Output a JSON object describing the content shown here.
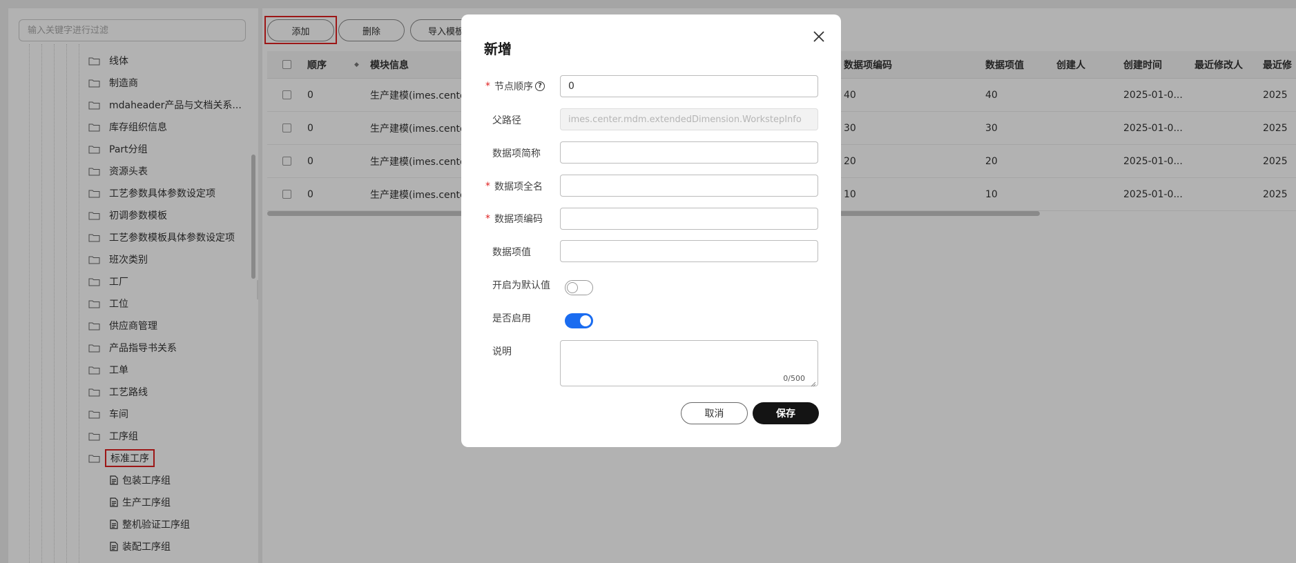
{
  "tree": {
    "filter_placeholder": "输入关键字进行过滤",
    "folders": [
      "线体",
      "制造商",
      "mdaheader产品与文档关系...",
      "库存组织信息",
      "Part分组",
      "资源头表",
      "工艺参数具体参数设定项",
      "初调参数模板",
      "工艺参数模板具体参数设定项",
      "班次类别",
      "工厂",
      "工位",
      "供应商管理",
      "产品指导书关系",
      "工单",
      "工艺路线",
      "车间",
      "工序组"
    ],
    "selected_folder": "标准工序",
    "children": [
      "包装工序组",
      "生产工序组",
      "整机验证工序组",
      "装配工序组"
    ]
  },
  "toolbar": {
    "add_label": "添加",
    "delete_label": "删除",
    "import_label": "导入模板"
  },
  "grid": {
    "headers": {
      "order": "顺序",
      "module": "模块信息",
      "code": "数据项编码",
      "value": "数据项值",
      "creator": "创建人",
      "created_time": "创建时间",
      "modifier": "最近修改人",
      "modified_time": "最近修"
    },
    "rows": [
      {
        "order": "0",
        "module": "生产建模(imes.center",
        "code": "40",
        "value": "40",
        "created": "2025-01-0...",
        "modified": "2025"
      },
      {
        "order": "0",
        "module": "生产建模(imes.center",
        "code": "30",
        "value": "30",
        "created": "2025-01-0...",
        "modified": "2025"
      },
      {
        "order": "0",
        "module": "生产建模(imes.center",
        "code": "20",
        "value": "20",
        "created": "2025-01-0...",
        "modified": "2025"
      },
      {
        "order": "0",
        "module": "生产建模(imes.center",
        "code": "10",
        "value": "10",
        "created": "2025-01-0...",
        "modified": "2025"
      }
    ]
  },
  "modal": {
    "title": "新增",
    "required_mark": "*",
    "help_glyph": "?",
    "node_order_label": "节点顺序",
    "node_order_value": "0",
    "parent_path_label": "父路径",
    "parent_path_value": "imes.center.mdm.extendedDimension.WorkstepInfo",
    "short_name_label": "数据项简称",
    "full_name_label": "数据项全名",
    "code_label": "数据项编码",
    "value_label": "数据项值",
    "default_label": "开启为默认值",
    "default_on": false,
    "enabled_label": "是否启用",
    "enabled_on": true,
    "desc_label": "说明",
    "desc_count": "0/500",
    "cancel_label": "取消",
    "save_label": "保存"
  },
  "colors": {
    "accent": "#1a6cf0",
    "highlight": "#e02020",
    "primary_button": "#141414",
    "required": "#e02020"
  }
}
